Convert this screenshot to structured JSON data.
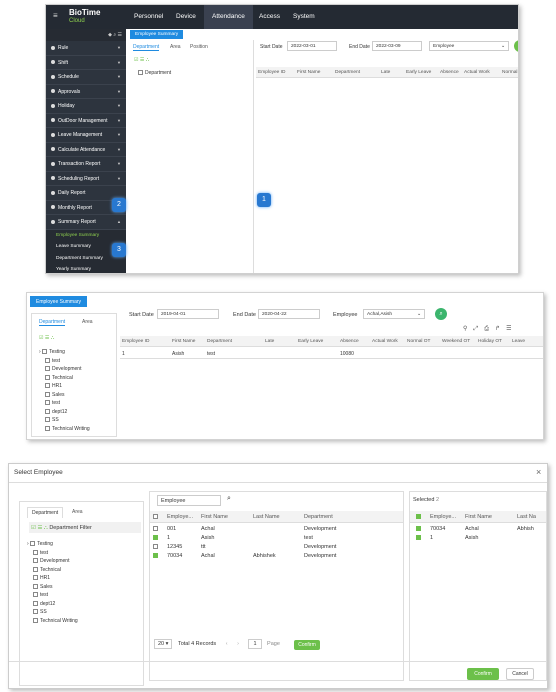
{
  "panel1": {
    "logo": {
      "brand": "BioTime",
      "sub": "Cloud"
    },
    "nav": [
      "Personnel",
      "Device",
      "Attendance",
      "Access",
      "System"
    ],
    "sidebar_items": [
      "Rule",
      "Shift",
      "Schedule",
      "Approvals",
      "Holiday",
      "OutDoor Management",
      "Leave Management",
      "Calculate Attendance",
      "Transaction Report",
      "Scheduling Report",
      "Daily Report",
      "Monthly Report",
      "Summary Report"
    ],
    "sidebar_subitems": [
      "Employee Summary",
      "Leave Summary",
      "Department Summary",
      "Yearly Summary"
    ],
    "tab_label": "Employee Summary",
    "left_tabs": [
      "Department",
      "Area",
      "Position"
    ],
    "tree_root": "Department",
    "start_label": "Start Date",
    "start_date": "2022-03-01",
    "end_label": "End Date",
    "end_date": "2022-03-09",
    "employee_select": "Employee",
    "columns": [
      "Employee ID",
      "First Name",
      "Department",
      "Late",
      "Early Leave",
      "Absence",
      "Actual Work",
      "Normal"
    ],
    "badges": [
      "1",
      "2",
      "3"
    ]
  },
  "panel2": {
    "tab_label": "Employee Summary",
    "left_tabs": [
      "Department",
      "Area"
    ],
    "start_label": "Start Date",
    "start_date": "2019-04-01",
    "end_label": "End Date",
    "end_date": "2020-04-22",
    "employee_label": "Employee",
    "employee_value": "Achal,Asish",
    "tree": [
      "Testing",
      "test",
      "Development",
      "Technical",
      "HR1",
      "Sales",
      "test",
      "dept12",
      "SS",
      "Technical Writing"
    ],
    "columns": [
      "Employee ID",
      "First Name",
      "Department",
      "Late",
      "Early Leave",
      "Absence",
      "Actual Work",
      "Normal OT",
      "Weekend OT",
      "Holiday OT",
      "Leave"
    ],
    "row": {
      "id": "1",
      "first": "Asish",
      "dept": "test",
      "absence": "10080"
    }
  },
  "panel3": {
    "title": "Select Employee",
    "close": "×",
    "left_tabs": [
      "Department",
      "Area"
    ],
    "dept_filter": "Department Filter",
    "tree": [
      "Testing",
      "test",
      "Development",
      "Technical",
      "HR1",
      "Sales",
      "test",
      "dept12",
      "SS",
      "Technical Writing"
    ],
    "search_value": "Employee",
    "columns": [
      "Employe...",
      "First Name",
      "Last Name",
      "Department"
    ],
    "rows": [
      {
        "id": "001",
        "first": "Achal",
        "last": "",
        "dept": "Development",
        "checked": false
      },
      {
        "id": "1",
        "first": "Asish",
        "last": "",
        "dept": "test",
        "checked": true
      },
      {
        "id": "12345",
        "first": "ttt",
        "last": "",
        "dept": "Development",
        "checked": false
      },
      {
        "id": "70034",
        "first": "Achal",
        "last": "Abhishek",
        "dept": "Development",
        "checked": true
      }
    ],
    "pager": {
      "size": "20",
      "total": "Total 4 Records",
      "page": "1",
      "page_label": "Page",
      "confirm": "Confirm"
    },
    "selected_label": "Selected",
    "selected_count": "2",
    "selected_columns": [
      "Employe...",
      "First Name",
      "Last Na"
    ],
    "selected_rows": [
      {
        "id": "70034",
        "first": "Achal",
        "last": "Abhish"
      },
      {
        "id": "1",
        "first": "Asish",
        "last": ""
      }
    ],
    "confirm": "Confirm",
    "cancel": "Cancel"
  }
}
